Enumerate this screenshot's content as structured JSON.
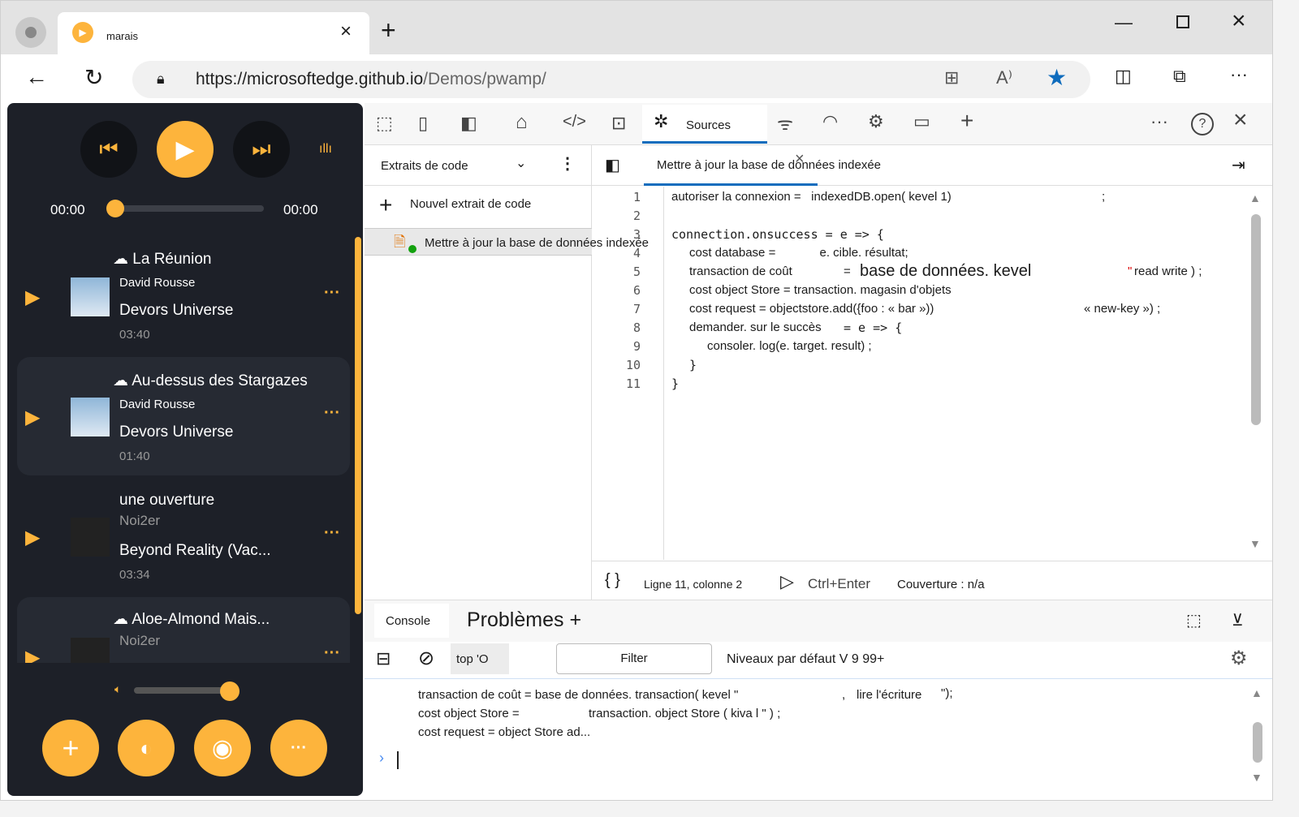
{
  "browser": {
    "tab_title": "marais",
    "url_host": "https://microsoftedge.github.io",
    "url_path": "/Demos/pwamp/"
  },
  "player": {
    "time_current": "00:00",
    "time_total": "00:00",
    "progress": 0,
    "volume": 0.85,
    "songs": [
      {
        "title": "La Réunion",
        "artist": "David",
        "artist2": "Rousse",
        "album": "Devors Universe",
        "duration": "03:40",
        "cloud": true
      },
      {
        "title": "Au-dessus des Stargazes",
        "artist": "David",
        "artist2": "Rousse",
        "album": "Devors Universe",
        "duration": "01:40",
        "cloud": true
      },
      {
        "title": "une ouverture",
        "artist": "Noi2er",
        "artist2": "",
        "album": "Beyond Reality (Vac...",
        "duration": "03:34",
        "cloud": false
      },
      {
        "title": "Aloe-Almond Mais...",
        "artist": "Noi2er",
        "artist2": "",
        "album": "",
        "duration": "",
        "cloud": true
      }
    ]
  },
  "devtools": {
    "active_tab": "Sources",
    "navigator": {
      "dropdown": "Extraits de code",
      "new_snippet": "Nouvel extrait de code",
      "snippet": "Mettre à jour la base de données indexée"
    },
    "editor": {
      "tab": "Mettre à jour la base de données indexée",
      "lines": [
        "autoriser la connexion =   indexedDB.open( kevel 1)",
        "",
        "connection.onsuccess = e => {",
        "cost database =             e. cible. résultat;",
        "transaction de coût",
        "cost object Store = transaction. magasin d'objets",
        "cost request = objectstore.add({foo : « bar »))",
        "demander. sur le succès",
        "consoler. log(e. target. result) ;",
        "}",
        "}"
      ],
      "line5_big": "base de données. kevel",
      "line5_end": "read write ) ;",
      "line7_end": "« new-key ») ;",
      "line1_end": ";",
      "status": {
        "position": "Ligne 11, colonne 2",
        "run": "Ctrl+Enter",
        "coverage": "Couverture : n/a"
      }
    },
    "drawer": {
      "tab_console": "Console",
      "tab_problems": "Problèmes +",
      "context": "top 'O",
      "filter": "Filter",
      "levels": "Niveaux par défaut V 9 99+",
      "output": [
        "transaction de coût = base de données. transaction( kevel \"",
        "lire l'écriture",
        "\");",
        "cost object Store =",
        "transaction. object Store ( kiva l \" ) ;",
        "cost request = object Store ad..."
      ]
    }
  },
  "colors": {
    "accent": "#fdb43c",
    "dark": "#1d2028",
    "blue": "#0f6cbd"
  }
}
